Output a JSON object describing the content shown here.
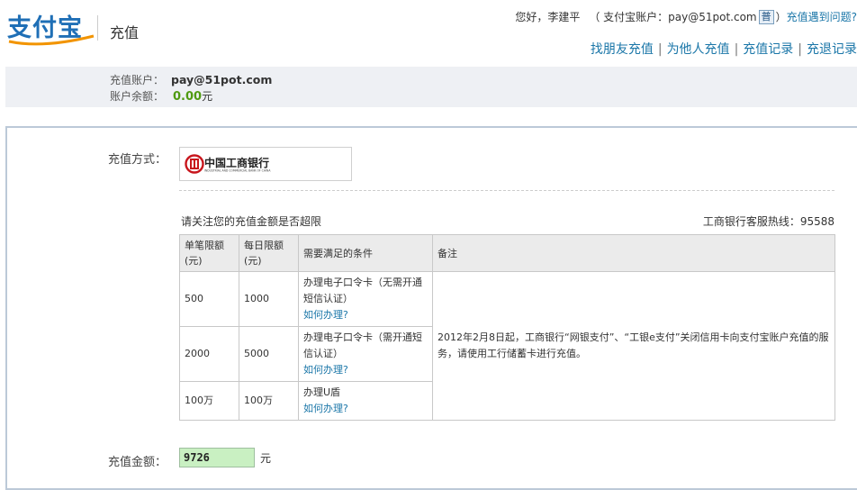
{
  "header": {
    "logo_text": "支付宝",
    "page_title": "充值",
    "greeting": "您好，李建平",
    "account_prefix": "（ 支付宝账户：",
    "account_email": "pay@51pot.com",
    "account_badge": "普",
    "account_suffix": "）",
    "help_link": "充值遇到问题?",
    "links": [
      "找朋友充值",
      "为他人充值",
      "充值记录",
      "充退记录"
    ]
  },
  "account_info": {
    "account_label": "充值账户：",
    "account_value": "pay@51pot.com",
    "balance_label": "账户余额：",
    "balance_value": "0.00",
    "balance_unit": "元"
  },
  "form": {
    "method_label": "充值方式：",
    "bank": {
      "name_cn": "中国工商银行",
      "name_en": "INDUSTRIAL AND COMMERCIAL BANK OF CHINA"
    },
    "notice": "请关注您的充值金额是否超限",
    "hotline": "工商银行客服热线：95588",
    "amount_label": "充值金额：",
    "amount_value": "9726",
    "amount_unit": "元"
  },
  "limits_table": {
    "headers": [
      "单笔限额(元)",
      "每日限额(元)",
      "需要满足的条件",
      "备注"
    ],
    "header_lines": [
      [
        "单笔限额",
        "(元)"
      ],
      [
        "每日限额",
        "(元)"
      ]
    ],
    "rows": [
      {
        "single": "500",
        "daily": "1000",
        "condition": "办理电子口令卡（无需开通短信认证）",
        "how": "如何办理?"
      },
      {
        "single": "2000",
        "daily": "5000",
        "condition": "办理电子口令卡（需开通短信认证）",
        "how": "如何办理?"
      },
      {
        "single": "100万",
        "daily": "100万",
        "condition": "办理U盾",
        "how": "如何办理?"
      }
    ],
    "remark": "2012年2月8日起，工商银行“网银支付”、“工银e支付”关闭信用卡向支付宝账户充值的服务，请使用工行储蓄卡进行充值。"
  },
  "colors": {
    "link": "#1a76a8",
    "balance": "#4f9a10",
    "logo": "#1f6fb6",
    "bank_red": "#c8161d",
    "input_bg": "#c9f0c2"
  }
}
